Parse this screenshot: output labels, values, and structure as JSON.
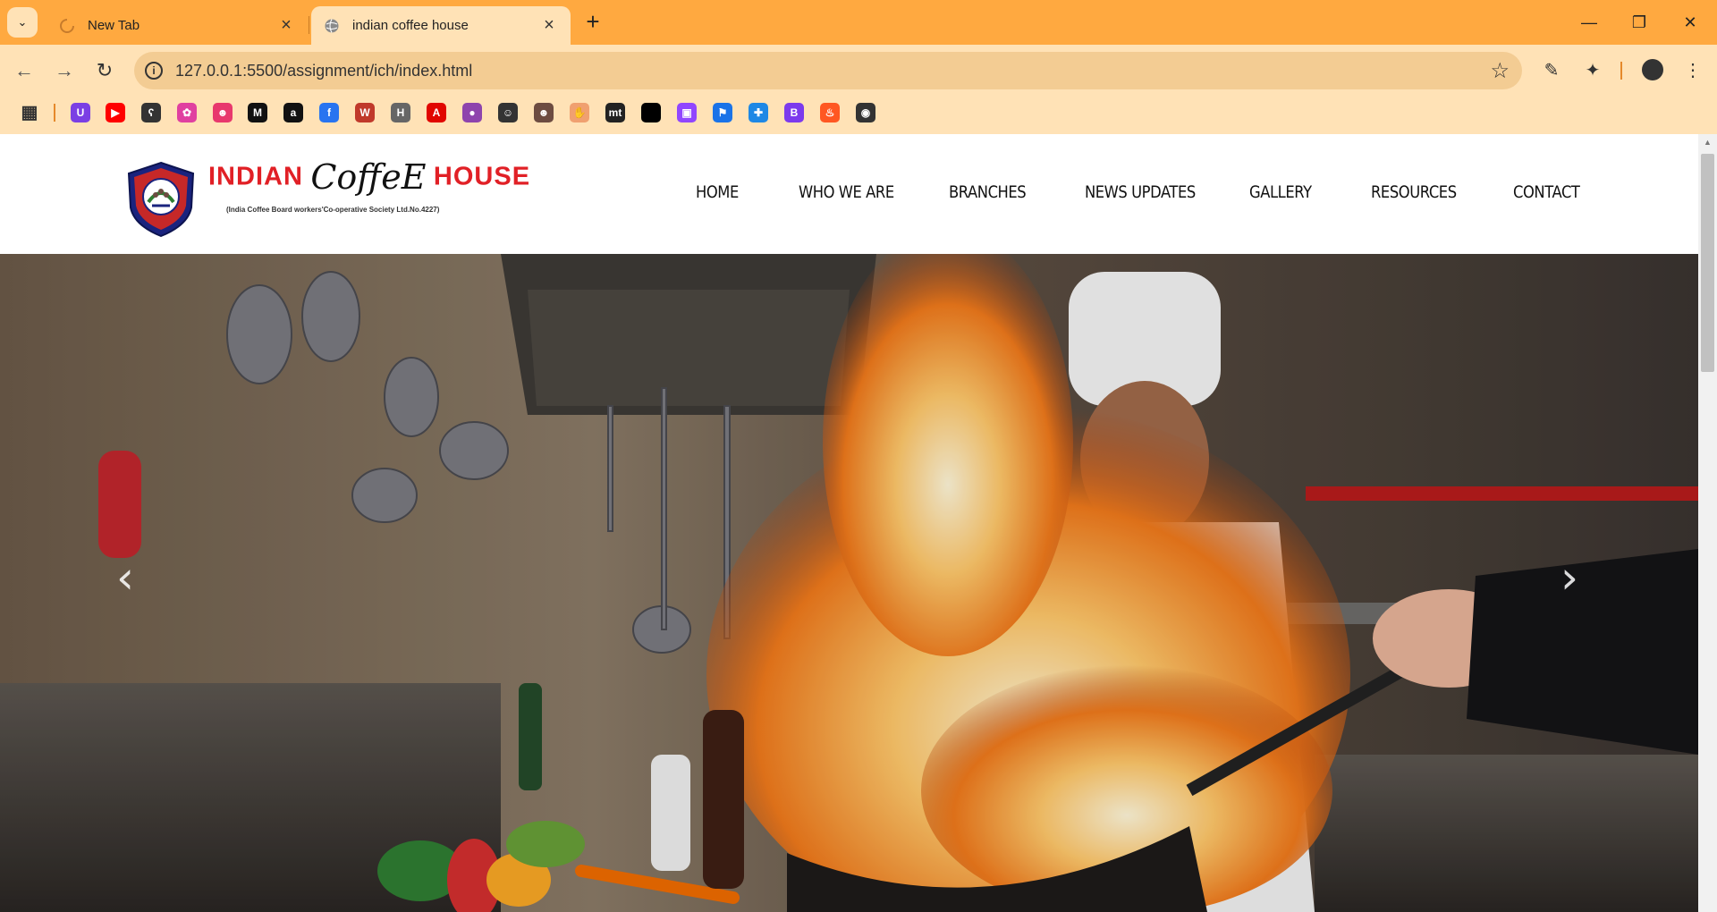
{
  "browser": {
    "tabs": [
      {
        "title": "New Tab",
        "active": false
      },
      {
        "title": "indian coffee house",
        "active": true
      }
    ],
    "url": "127.0.0.1:5500/assignment/ich/index.html",
    "new_tab_symbol": "+",
    "bookmarks": [
      {
        "icon": "apps-grid-icon",
        "color": "#333333"
      },
      {
        "icon": "u-icon",
        "color": "#7b3fe4"
      },
      {
        "icon": "youtube-icon",
        "color": "#ff0000"
      },
      {
        "icon": "bear-icon",
        "color": "#333333"
      },
      {
        "icon": "flower-icon",
        "color": "#e040a0"
      },
      {
        "icon": "robot-icon",
        "color": "#e8386d"
      },
      {
        "icon": "m-icon",
        "color": "#111111"
      },
      {
        "icon": "amazon-icon",
        "color": "#111111"
      },
      {
        "icon": "flipkart-icon",
        "color": "#2874f0"
      },
      {
        "icon": "w-icon",
        "color": "#c0392b"
      },
      {
        "icon": "h-icon",
        "color": "#666666"
      },
      {
        "icon": "a-icon",
        "color": "#e10600"
      },
      {
        "icon": "planet-icon",
        "color": "#8e44ad"
      },
      {
        "icon": "face-icon",
        "color": "#333333"
      },
      {
        "icon": "avatar-icon",
        "color": "#6d4c41"
      },
      {
        "icon": "hand-icon",
        "color": "#f0a070"
      },
      {
        "icon": "mt-icon",
        "color": "#222222"
      },
      {
        "icon": "black-square-icon",
        "color": "#000000"
      },
      {
        "icon": "twitch-icon",
        "color": "#9146ff"
      },
      {
        "icon": "flag-icon",
        "color": "#1a73e8"
      },
      {
        "icon": "puzzle-icon",
        "color": "#1e88e5"
      },
      {
        "icon": "b-icon",
        "color": "#7c3aed"
      },
      {
        "icon": "fire-icon",
        "color": "#ff5722"
      },
      {
        "icon": "github-icon",
        "color": "#333333"
      }
    ]
  },
  "site": {
    "brand": {
      "word1": "INDIAN",
      "word2": "CoffeE",
      "word3": "HOUSE",
      "tagline": "(India Coffee Board workers'Co-operative Society Ltd.No.4227)",
      "emblem_text": "I.C.B.W.C.S. LTD. 4227"
    },
    "nav": [
      {
        "label": "HOME"
      },
      {
        "label": "WHO WE ARE"
      },
      {
        "label": "BRANCHES"
      },
      {
        "label": "NEWS UPDATES"
      },
      {
        "label": "GALLERY"
      },
      {
        "label": "RESOURCES"
      },
      {
        "label": "CONTACT"
      }
    ],
    "carousel": {
      "prev_symbol": "‹",
      "next_symbol": "›"
    }
  },
  "colors": {
    "chrome_tabbar": "#ffa940",
    "chrome_toolbar": "#ffe2b6",
    "brand_red": "#e12026"
  }
}
